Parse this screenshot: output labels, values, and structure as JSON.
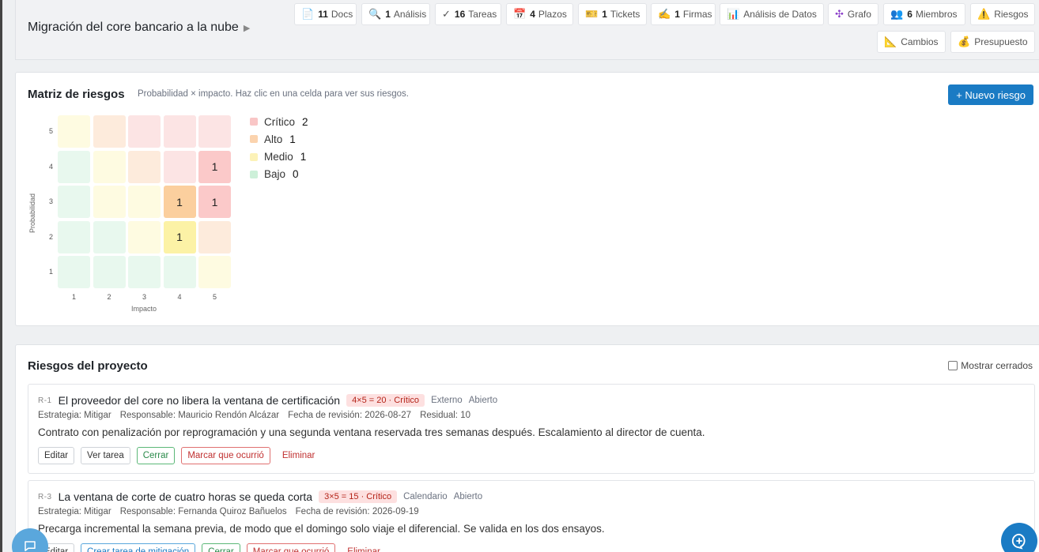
{
  "project": {
    "title": "Migración del core bancario a la nube",
    "expand_glyph": "▶"
  },
  "chips": [
    {
      "icon": "📄",
      "icon_name": "document-icon",
      "count": "11",
      "label": "Docs"
    },
    {
      "icon": "🔍",
      "icon_name": "search-icon",
      "count": "1",
      "label": "Análisis"
    },
    {
      "icon": "✓",
      "icon_name": "check-icon",
      "count": "16",
      "label": "Tareas"
    },
    {
      "icon": "📅",
      "icon_name": "calendar-icon",
      "count": "4",
      "label": "Plazos"
    },
    {
      "icon": "🎫",
      "icon_name": "ticket-icon",
      "count": "1",
      "label": "Tickets"
    },
    {
      "icon": "✍️",
      "icon_name": "signature-icon",
      "count": "1",
      "label": "Firmas"
    },
    {
      "icon": "📊",
      "icon_name": "bar-chart-icon",
      "count": "",
      "label": "Análisis de Datos"
    },
    {
      "icon": "✣",
      "icon_name": "graph-icon",
      "count": "",
      "label": "Grafo"
    },
    {
      "icon": "👥",
      "icon_name": "members-icon",
      "count": "6",
      "label": "Miembros"
    },
    {
      "icon": "⚠️",
      "icon_name": "warning-icon",
      "count": "",
      "label": "Riesgos"
    },
    {
      "icon": "📐",
      "icon_name": "ruler-icon",
      "count": "",
      "label": "Cambios"
    },
    {
      "icon": "💰",
      "icon_name": "money-bag-icon",
      "count": "",
      "label": "Presupuesto"
    }
  ],
  "matrix": {
    "title": "Matriz de riesgos",
    "subtitle": "Probabilidad × impacto. Haz clic en una celda para ver sus riesgos.",
    "new_button": "+ Nuevo riesgo",
    "x_label": "Impacto",
    "y_label": "Probabilidad",
    "x_ticks": [
      "1",
      "2",
      "3",
      "4",
      "5"
    ],
    "y_ticks": [
      "5",
      "4",
      "3",
      "2",
      "1"
    ],
    "colors": {
      "critico": "#fce4e4",
      "alto": "#fdebdc",
      "medio": "#fefbe1",
      "bajo": "#e8f8ee"
    },
    "cells": [
      {
        "prob": 5,
        "impact": 1,
        "level": "medio",
        "count": ""
      },
      {
        "prob": 5,
        "impact": 2,
        "level": "alto",
        "count": ""
      },
      {
        "prob": 5,
        "impact": 3,
        "level": "critico",
        "count": ""
      },
      {
        "prob": 5,
        "impact": 4,
        "level": "critico",
        "count": ""
      },
      {
        "prob": 5,
        "impact": 5,
        "level": "critico",
        "count": ""
      },
      {
        "prob": 4,
        "impact": 1,
        "level": "bajo",
        "count": ""
      },
      {
        "prob": 4,
        "impact": 2,
        "level": "medio",
        "count": ""
      },
      {
        "prob": 4,
        "impact": 3,
        "level": "alto",
        "count": ""
      },
      {
        "prob": 4,
        "impact": 4,
        "level": "critico",
        "count": ""
      },
      {
        "prob": 4,
        "impact": 5,
        "level": "critico_hl",
        "count": "1"
      },
      {
        "prob": 3,
        "impact": 1,
        "level": "bajo",
        "count": ""
      },
      {
        "prob": 3,
        "impact": 2,
        "level": "medio",
        "count": ""
      },
      {
        "prob": 3,
        "impact": 3,
        "level": "medio",
        "count": ""
      },
      {
        "prob": 3,
        "impact": 4,
        "level": "alto_hl",
        "count": "1"
      },
      {
        "prob": 3,
        "impact": 5,
        "level": "critico_hl",
        "count": "1"
      },
      {
        "prob": 2,
        "impact": 1,
        "level": "bajo",
        "count": ""
      },
      {
        "prob": 2,
        "impact": 2,
        "level": "bajo",
        "count": ""
      },
      {
        "prob": 2,
        "impact": 3,
        "level": "medio",
        "count": ""
      },
      {
        "prob": 2,
        "impact": 4,
        "level": "medio_hl",
        "count": "1"
      },
      {
        "prob": 2,
        "impact": 5,
        "level": "alto",
        "count": ""
      },
      {
        "prob": 1,
        "impact": 1,
        "level": "bajo",
        "count": ""
      },
      {
        "prob": 1,
        "impact": 2,
        "level": "bajo",
        "count": ""
      },
      {
        "prob": 1,
        "impact": 3,
        "level": "bajo",
        "count": ""
      },
      {
        "prob": 1,
        "impact": 4,
        "level": "bajo",
        "count": ""
      },
      {
        "prob": 1,
        "impact": 5,
        "level": "medio",
        "count": ""
      }
    ],
    "legend": [
      {
        "label": "Crítico",
        "count": "2",
        "color": "#f9c6c6"
      },
      {
        "label": "Alto",
        "count": "1",
        "color": "#fbd3ae"
      },
      {
        "label": "Medio",
        "count": "1",
        "color": "#fcf2b8"
      },
      {
        "label": "Bajo",
        "count": "0",
        "color": "#cdf0d9"
      }
    ]
  },
  "risks_section": {
    "title": "Riesgos del proyecto",
    "show_closed_label": "Mostrar cerrados",
    "risks": [
      {
        "id": "R-1",
        "title": "El proveedor del core no libera la ventana de certificación",
        "score": "4×5 = 20 · Crítico",
        "category": "Externo",
        "status": "Abierto",
        "strategy": "Estrategia: Mitigar",
        "owner": "Responsable: Mauricio Rendón Alcázar",
        "review": "Fecha de revisión: 2026-08-27",
        "residual": "Residual: 10",
        "description": "Contrato con penalización por reprogramación y una segunda ventana reservada tres semanas después. Escalamiento al director de cuenta.",
        "actions": [
          {
            "label": "Editar",
            "style": "",
            "name": "edit-button"
          },
          {
            "label": "Ver tarea",
            "style": "",
            "name": "view-task-button"
          },
          {
            "label": "Cerrar",
            "style": "green",
            "name": "close-risk-button"
          },
          {
            "label": "Marcar que ocurrió",
            "style": "red",
            "name": "mark-occurred-button"
          },
          {
            "label": "Eliminar",
            "style": "plain-red",
            "name": "delete-button"
          }
        ]
      },
      {
        "id": "R-3",
        "title": "La ventana de corte de cuatro horas se queda corta",
        "score": "3×5 = 15 · Crítico",
        "category": "Calendario",
        "status": "Abierto",
        "strategy": "Estrategia: Mitigar",
        "owner": "Responsable: Fernanda Quiroz Bañuelos",
        "review": "Fecha de revisión: 2026-09-19",
        "residual": "",
        "description": "Precarga incremental la semana previa, de modo que el domingo solo viaje el diferencial. Se valida en los dos ensayos.",
        "actions": [
          {
            "label": "Editar",
            "style": "",
            "name": "edit-button"
          },
          {
            "label": "Crear tarea de mitigación",
            "style": "blue",
            "name": "create-mitigation-task-button"
          },
          {
            "label": "Cerrar",
            "style": "green",
            "name": "close-risk-button"
          },
          {
            "label": "Marcar que ocurrió",
            "style": "red",
            "name": "mark-occurred-button"
          },
          {
            "label": "Eliminar",
            "style": "plain-red",
            "name": "delete-button"
          }
        ]
      }
    ]
  }
}
